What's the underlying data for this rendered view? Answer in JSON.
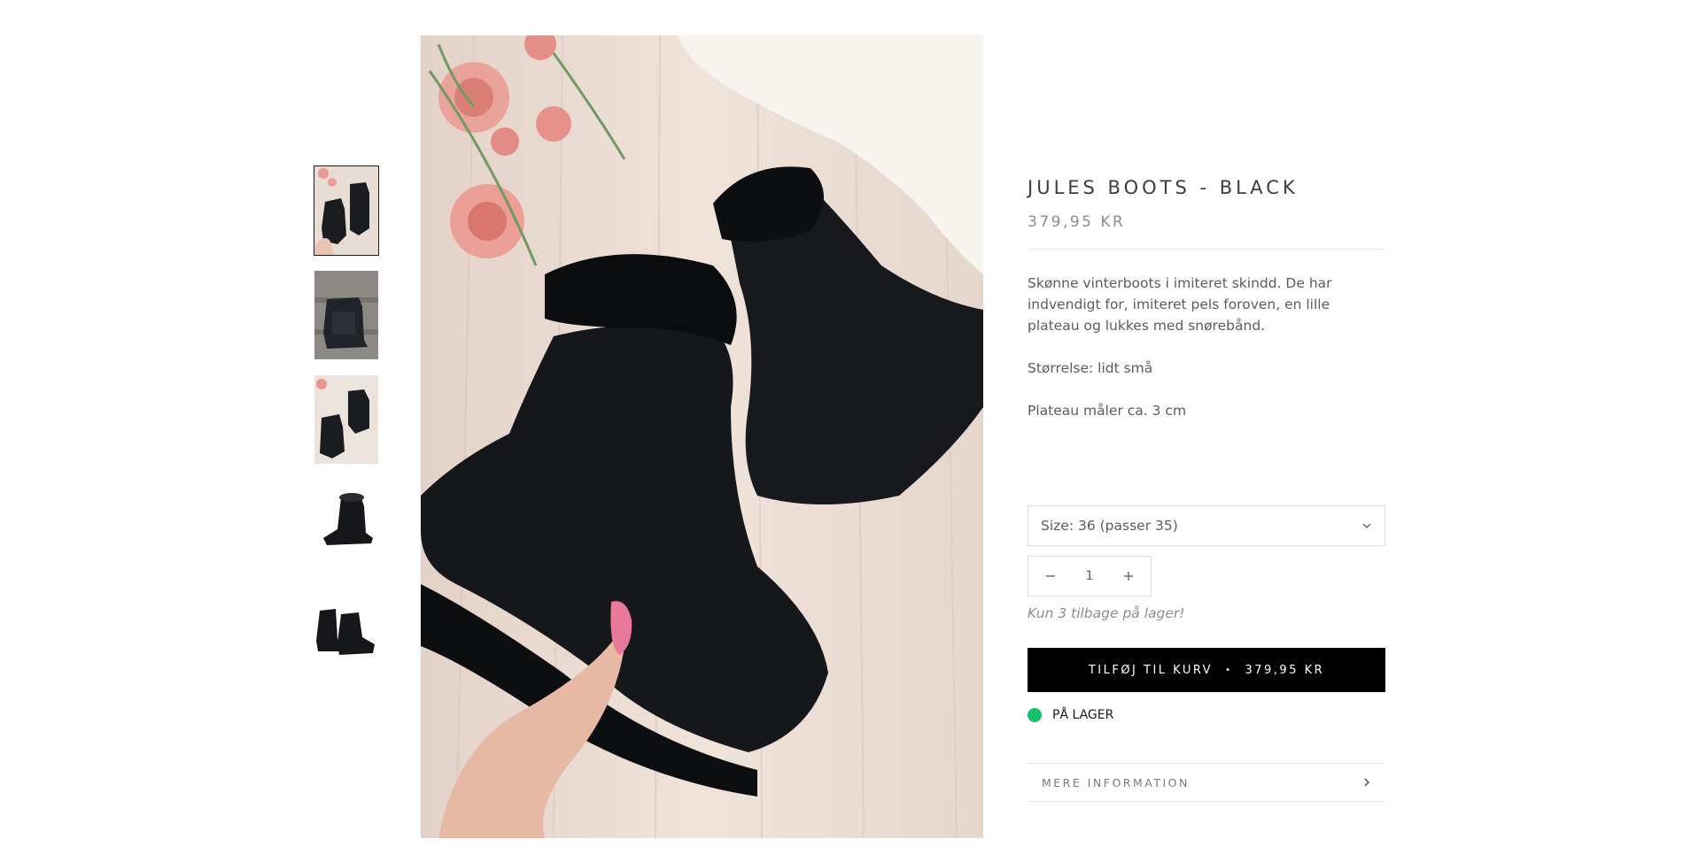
{
  "product": {
    "title": "JULES BOOTS - BLACK",
    "price": "379,95 KR",
    "description": [
      "Skønne vinterboots i imiteret skindd. De har indvendigt for, imiteret pels foroven, en lille plateau og lukkes med snørebånd.",
      "Størrelse: lidt små",
      "Plateau måler ca. 3 cm"
    ]
  },
  "variant": {
    "size_label": "Size: 36 (passer 35)",
    "chevron_icon": "chevron-down-icon"
  },
  "quantity": {
    "value": "1",
    "minus_icon": "minus-icon",
    "plus_icon": "plus-icon"
  },
  "stock": {
    "note": "Kun 3 tilbage på lager!",
    "status": "PÅ LAGER",
    "status_color": "#15c26b"
  },
  "cart": {
    "button_label": "TILFØJ TIL KURV",
    "separator": "•",
    "button_price": "379,95 KR"
  },
  "more_info": {
    "label": "MERE INFORMATION",
    "icon": "chevron-right-icon"
  },
  "gallery": {
    "thumbnails": [
      {
        "name": "boots-on-wood-with-flowers",
        "active": true
      },
      {
        "name": "boots-on-stone-steps",
        "active": false
      },
      {
        "name": "two-boots-on-wood",
        "active": false
      },
      {
        "name": "single-boot-white-background",
        "active": false
      },
      {
        "name": "pair-of-boots-white-background",
        "active": false
      }
    ],
    "main": "boot-held-in-hand-over-wood-floor"
  },
  "colors": {
    "button_bg": "#000000",
    "button_text": "#ffffff",
    "border": "#dddddd"
  }
}
